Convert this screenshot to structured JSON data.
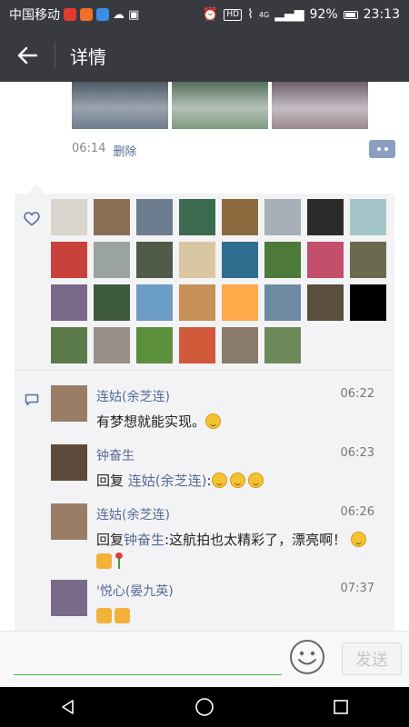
{
  "status_bar": {
    "carrier": "中国移动",
    "hd": "HD",
    "network": "4G",
    "battery": "92%",
    "time": "23:13",
    "app_icon_colors": [
      "#e33b2e",
      "#f07025",
      "#3a8ee6"
    ]
  },
  "header": {
    "title": "详情",
    "back_icon": "arrow-left-icon"
  },
  "post": {
    "photo_colors": [
      [
        "#6f7c8c",
        "#9aa4ae",
        "#4e5a66"
      ],
      [
        "#7f9a80",
        "#b4c2b9",
        "#56705c"
      ],
      [
        "#9a8a90",
        "#c6bcc4",
        "#70606a"
      ]
    ],
    "time": "06:14",
    "delete_label": "删除",
    "more_icon": "more-icon"
  },
  "likes": {
    "icon": "heart-icon",
    "avatar_colors": [
      "#d9d4cc",
      "#8a6f55",
      "#6b7d8f",
      "#3a6b4f",
      "#8c6b3f",
      "#a7b0b8",
      "#2b2b2b",
      "#a5c6c9",
      "#c8423b",
      "#9aa39d",
      "#4f5b48",
      "#d9c7a2",
      "#2f6e8e",
      "#4d7a3b",
      "#c44f6b",
      "#6b6a4f",
      "#7a6a8a",
      "#3d5a3d",
      "#6b9cc8",
      "#c79058",
      "#ffa94a",
      "#6e8aa3",
      "#5a4e3e",
      "#000000",
      "#5b7a4a",
      "#9a8f86",
      "#5c8f3b",
      "#d15a3a",
      "#8a7a6a",
      "#6d8a5a"
    ]
  },
  "comments_icon": "comment-icon",
  "comments": [
    {
      "name": "连姑(余芝连)",
      "time": "06:22",
      "text": "有梦想就能实现。",
      "avatar_color": "#9a7d67"
    },
    {
      "name": "钟奋生",
      "time": "06:23",
      "reply_prefix": "回复",
      "reply_to": "连姑(余芝连)",
      "reply_suffix": ":",
      "avatar_color": "#5d4a3a"
    },
    {
      "name": "连姑(余芝连)",
      "time": "06:26",
      "reply_prefix": "回复",
      "reply_to": "钟奋生",
      "reply_suffix": ":这航拍也太精彩了，漂亮啊！",
      "avatar_color": "#9a7d67"
    },
    {
      "name": "'悦心(晏九英)",
      "time": "07:37",
      "avatar_color": "#7a6a8a"
    }
  ],
  "input_bar": {
    "emoji_icon": "smiley-icon",
    "send_label": "发送"
  },
  "nav": {
    "back_icon": "nav-back-icon",
    "home_icon": "nav-home-icon",
    "recents_icon": "nav-recents-icon"
  }
}
